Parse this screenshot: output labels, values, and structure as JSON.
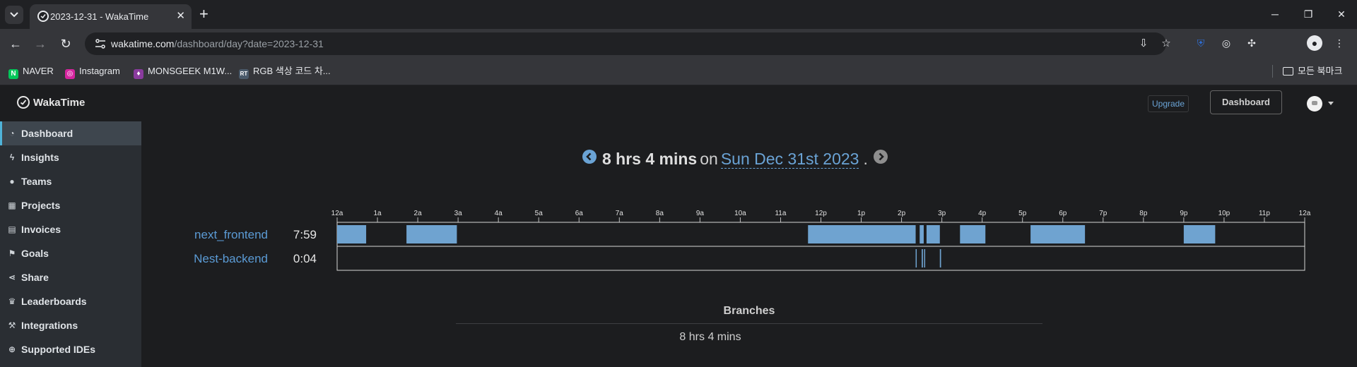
{
  "browser": {
    "tab_title": "2023-12-31 - WakaTime",
    "url_host": "wakatime.com",
    "url_path": "/dashboard/day?date=2023-12-31",
    "bookmarks": [
      {
        "label": "NAVER",
        "icon": "naver-icon",
        "color": "#03c75a"
      },
      {
        "label": "Instagram",
        "icon": "instagram-icon",
        "color": "#d6249f"
      },
      {
        "label": "MONSGEEK M1W...",
        "icon": "monsgeek-icon",
        "color": "#8a3b9e"
      },
      {
        "label": "RGB 색상 코드 차...",
        "icon": "rgb-icon",
        "color": "#4a5a6a"
      }
    ],
    "all_bookmarks_label": "모든 북마크"
  },
  "header": {
    "brand": "WakaTime",
    "upgrade_label": "Upgrade",
    "dashboard_label": "Dashboard"
  },
  "sidebar": {
    "items": [
      {
        "label": "Dashboard",
        "icon": "dashboard-icon",
        "active": true
      },
      {
        "label": "Insights",
        "icon": "bolt-icon"
      },
      {
        "label": "Teams",
        "icon": "users-icon"
      },
      {
        "label": "Projects",
        "icon": "grid-icon"
      },
      {
        "label": "Invoices",
        "icon": "invoice-icon"
      },
      {
        "label": "Goals",
        "icon": "flag-icon"
      },
      {
        "label": "Share",
        "icon": "share-icon"
      },
      {
        "label": "Leaderboards",
        "icon": "trophy-icon"
      },
      {
        "label": "Integrations",
        "icon": "wrench-icon"
      },
      {
        "label": "Supported IDEs",
        "icon": "plus-circle-icon"
      }
    ]
  },
  "day": {
    "total": "8 hrs 4 mins",
    "on": "on",
    "date": "Sun Dec 31st 2023",
    "dot": "."
  },
  "chart_data": {
    "type": "timeline",
    "x_ticks": [
      "12a",
      "1a",
      "2a",
      "3a",
      "4a",
      "5a",
      "6a",
      "7a",
      "8a",
      "9a",
      "10a",
      "11a",
      "12p",
      "1p",
      "2p",
      "3p",
      "4p",
      "5p",
      "6p",
      "7p",
      "8p",
      "9p",
      "10p",
      "11p",
      "12a"
    ],
    "xlim": [
      0,
      24
    ],
    "accent": "#6fa3d0",
    "series": [
      {
        "name": "next_frontend",
        "total": "7:59",
        "segments": [
          [
            0.0,
            0.72
          ],
          [
            1.72,
            2.97
          ],
          [
            11.68,
            14.35
          ],
          [
            14.45,
            14.55
          ],
          [
            14.62,
            14.95
          ],
          [
            15.45,
            16.08
          ],
          [
            17.2,
            18.55
          ],
          [
            21.0,
            21.78
          ]
        ]
      },
      {
        "name": "Nest-backend",
        "total": "0:04",
        "segments": [
          [
            14.35,
            14.37
          ],
          [
            14.5,
            14.53
          ],
          [
            14.56,
            14.58
          ],
          [
            14.95,
            14.98
          ]
        ]
      }
    ]
  },
  "branches": {
    "title": "Branches",
    "total": "8 hrs 4 mins"
  }
}
